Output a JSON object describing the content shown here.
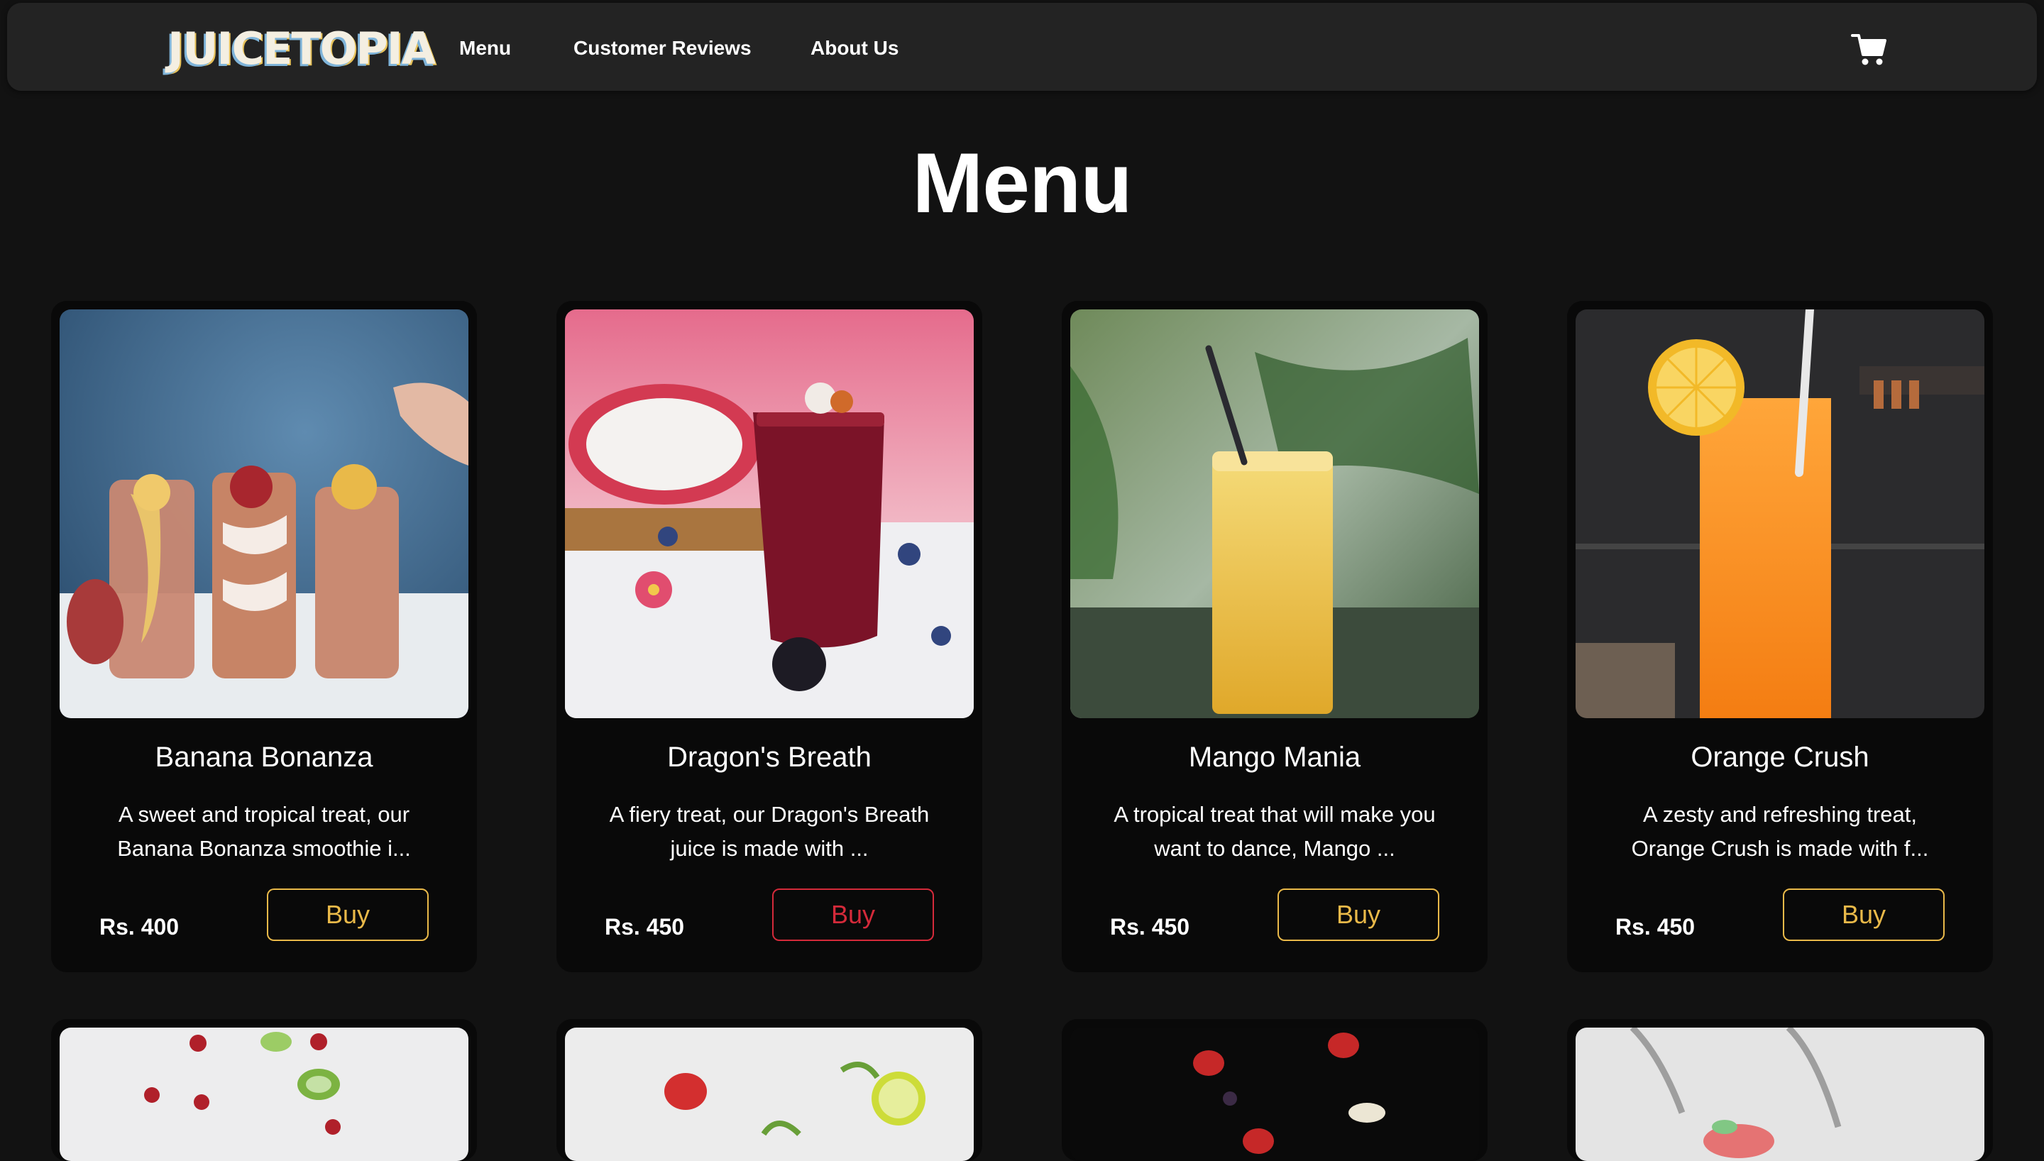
{
  "nav": {
    "logo": "JUICETOPIA",
    "links": [
      "Menu",
      "Customer Reviews",
      "About Us"
    ],
    "cart_icon": "shopping-cart-icon"
  },
  "page": {
    "title": "Menu"
  },
  "products": [
    {
      "name": "Banana Bonanza",
      "description": "A sweet and tropical treat, our Banana Bonanza smoothie i...",
      "price": "Rs. 400",
      "buy_label": "Buy",
      "button_color": "#e9b949"
    },
    {
      "name": "Dragon's Breath",
      "description": "A fiery treat, our Dragon's Breath juice is made with ...",
      "price": "Rs. 450",
      "buy_label": "Buy",
      "button_color": "#d42a3a"
    },
    {
      "name": "Mango Mania",
      "description": "A tropical treat that will make you want to dance, Mango ...",
      "price": "Rs. 450",
      "buy_label": "Buy",
      "button_color": "#e9b949"
    },
    {
      "name": "Orange Crush",
      "description": "A zesty and refreshing treat, Orange Crush is made with f...",
      "price": "Rs. 450",
      "buy_label": "Buy",
      "button_color": "#e9b949"
    }
  ],
  "colors": {
    "background": "#121212",
    "navbar": "#232323",
    "card": "#090909",
    "accent_gold": "#e9b949",
    "accent_red": "#d42a3a"
  }
}
